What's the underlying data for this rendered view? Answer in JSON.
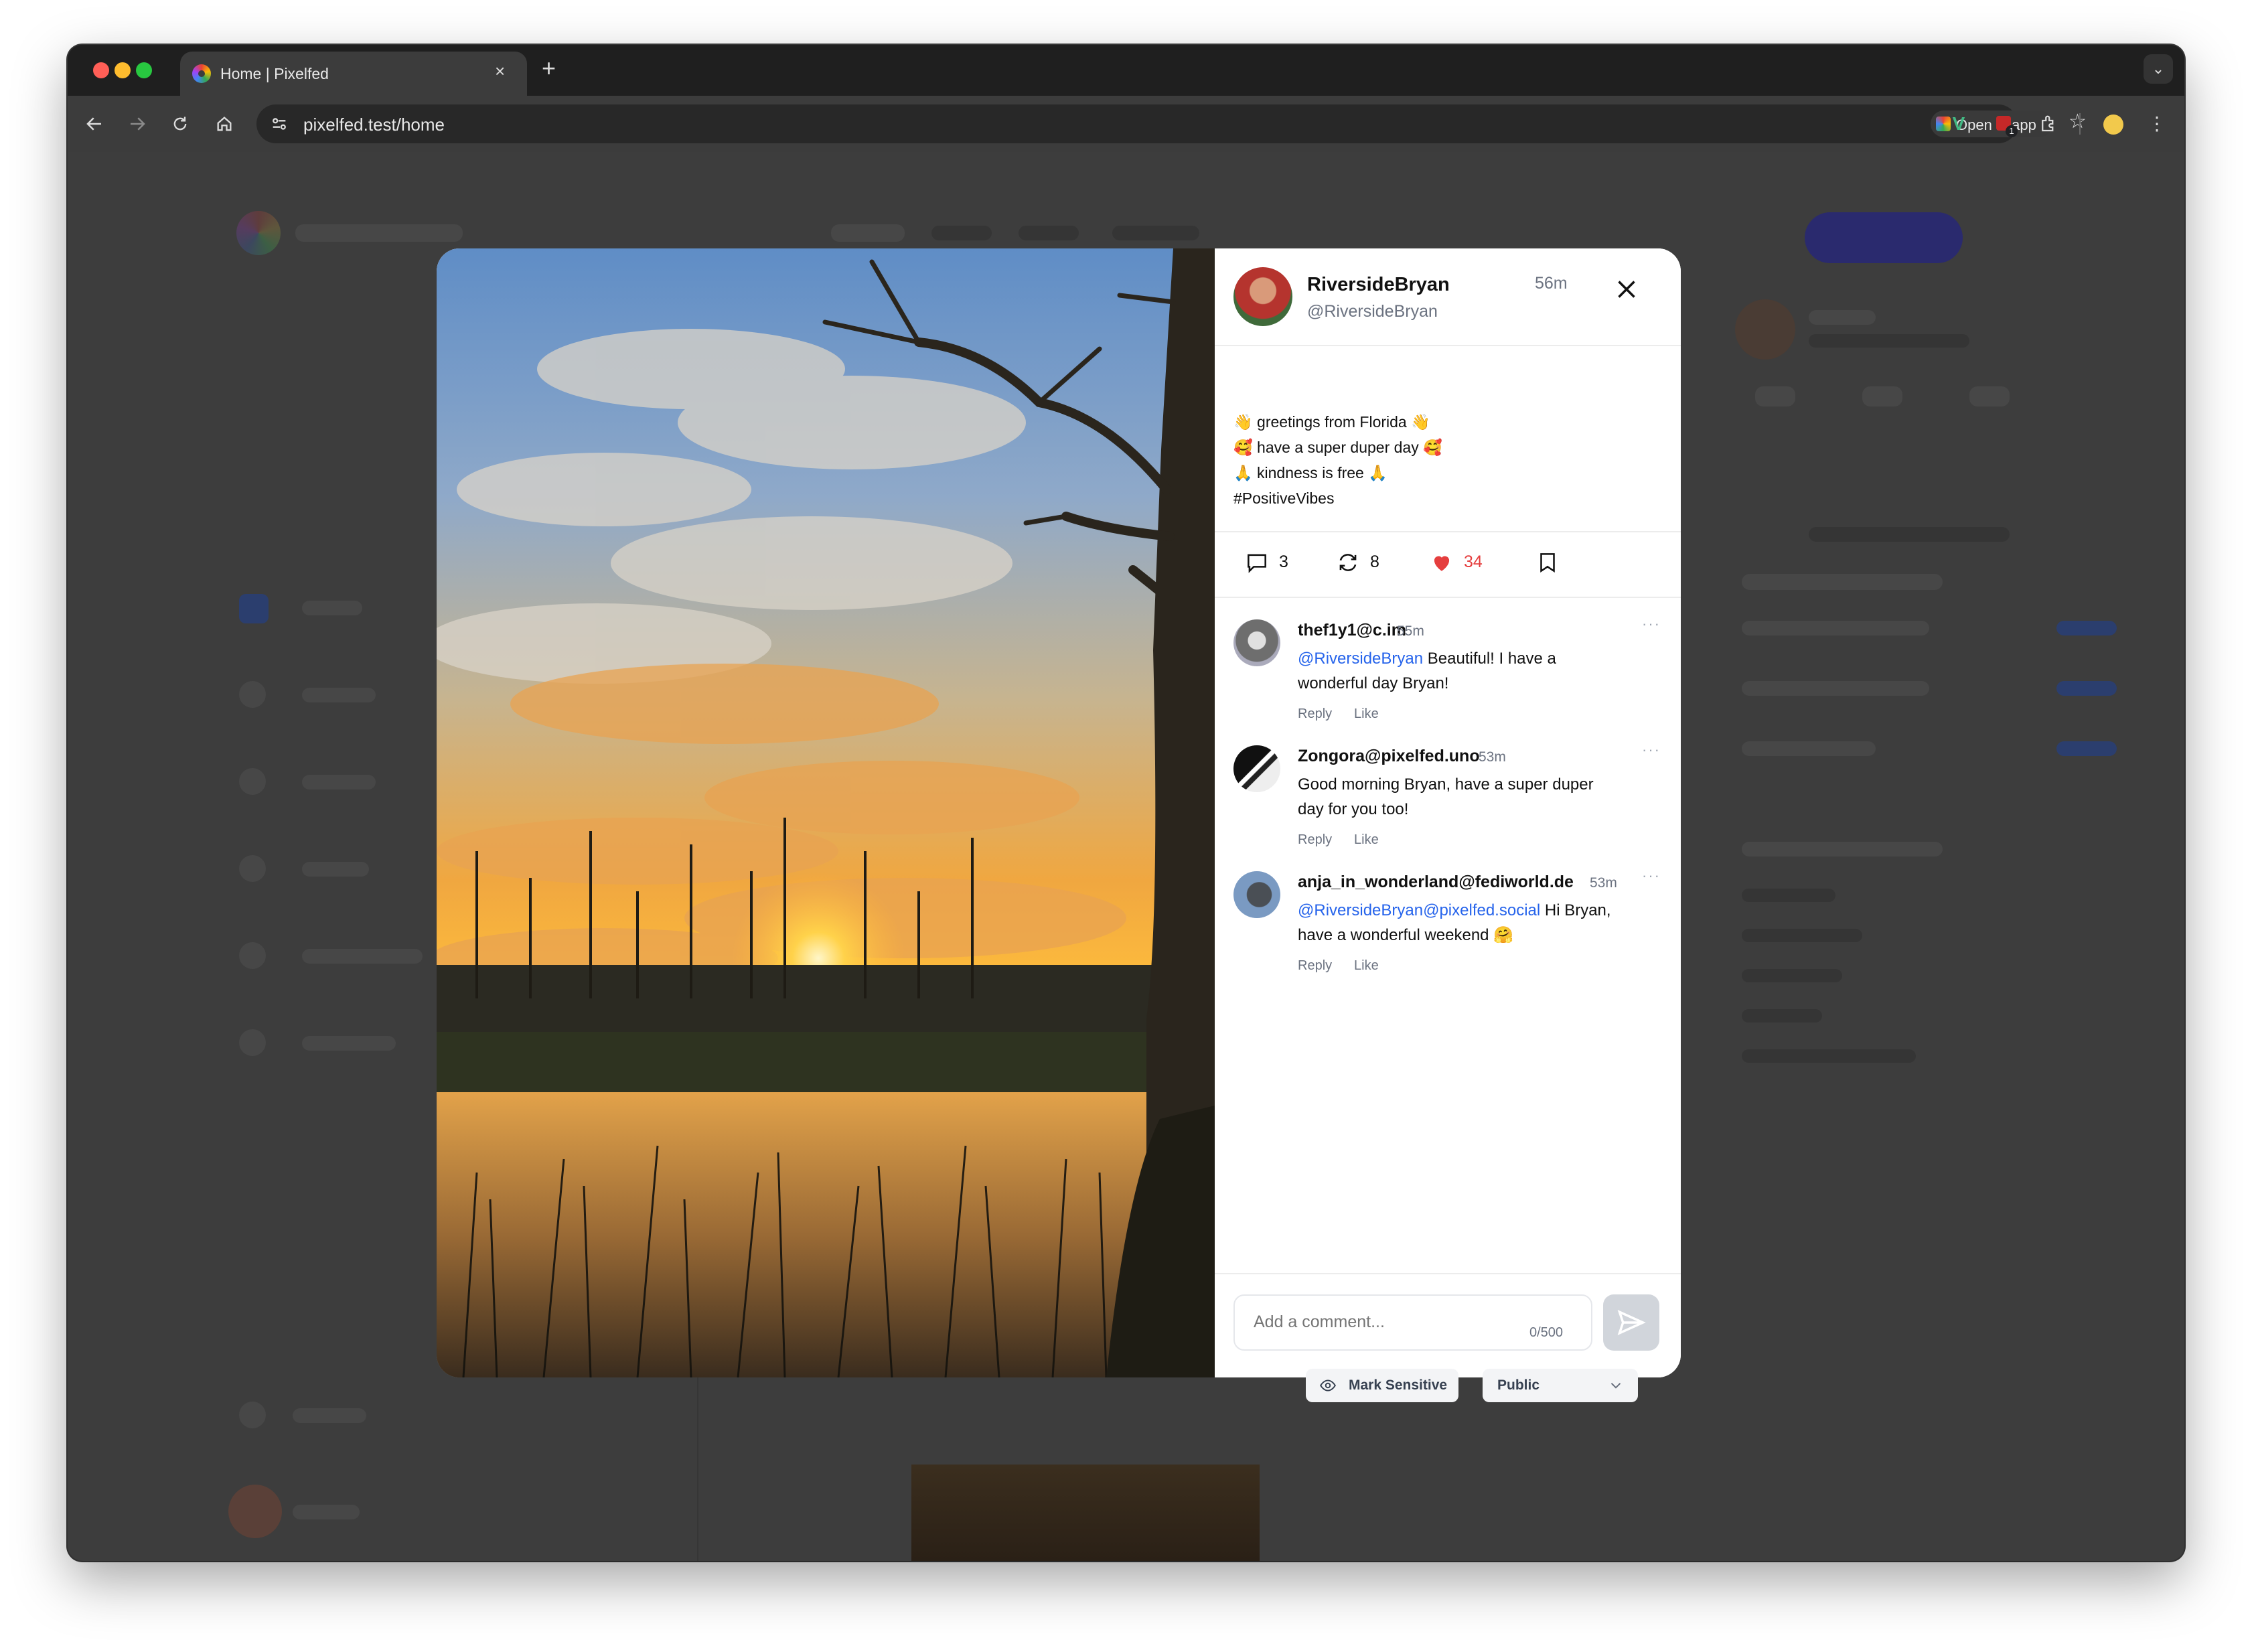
{
  "browser": {
    "tab_title": "Home | Pixelfed",
    "tab_close": "×",
    "new_tab": "+",
    "url": "pixelfed.test/home",
    "open_in_app": "Open in app",
    "tab_menu": "⌄",
    "extension_badge": "1"
  },
  "post": {
    "author_name": "RiversideBryan",
    "author_handle": "@RiversideBryan",
    "time": "56m",
    "caption_lines": [
      "👋 greetings from Florida 👋",
      "🥰 have a super duper day 🥰",
      "🙏 kindness is free 🙏"
    ],
    "hashtag": "#PositiveVibes",
    "comments_count": "3",
    "shares_count": "8",
    "likes_count": "34"
  },
  "comments": [
    {
      "name": "thef1y1@c.im",
      "time": "55m",
      "mention": "@RiversideBryan",
      "text": " Beautiful! I have a wonderful day Bryan!",
      "reply": "Reply",
      "like": "Like",
      "more": "···"
    },
    {
      "name": "Zongora@pixelfed.uno",
      "time": "53m",
      "mention": "",
      "text": "Good morning Bryan, have a super duper day for you too!",
      "reply": "Reply",
      "like": "Like",
      "more": "···"
    },
    {
      "name": "anja_in_wonderland@fediworld.de",
      "time": "53m",
      "mention": "@RiversideBryan@pixelfed.social",
      "text": " Hi Bryan, have a wonderful weekend 🤗",
      "reply": "Reply",
      "like": "Like",
      "more": "···"
    }
  ],
  "composer": {
    "placeholder": "Add a comment...",
    "counter": "0/500",
    "mark_sensitive": "Mark Sensitive",
    "visibility": "Public"
  },
  "colors": {
    "like_red": "#e53e3e",
    "link_blue": "#2563eb",
    "window_dark": "#1f1f1f"
  },
  "icons": [
    "back-arrow-icon",
    "forward-arrow-icon",
    "reload-icon",
    "home-icon",
    "site-settings-icon",
    "bookmark-star-icon",
    "vue-devtools-icon",
    "extension-icon",
    "puzzle-extensions-icon",
    "profile-avatar-icon",
    "kebab-menu-icon",
    "close-icon",
    "comment-icon",
    "repost-icon",
    "heart-icon",
    "bookmark-icon",
    "send-icon",
    "eye-icon",
    "chevron-down-icon"
  ]
}
